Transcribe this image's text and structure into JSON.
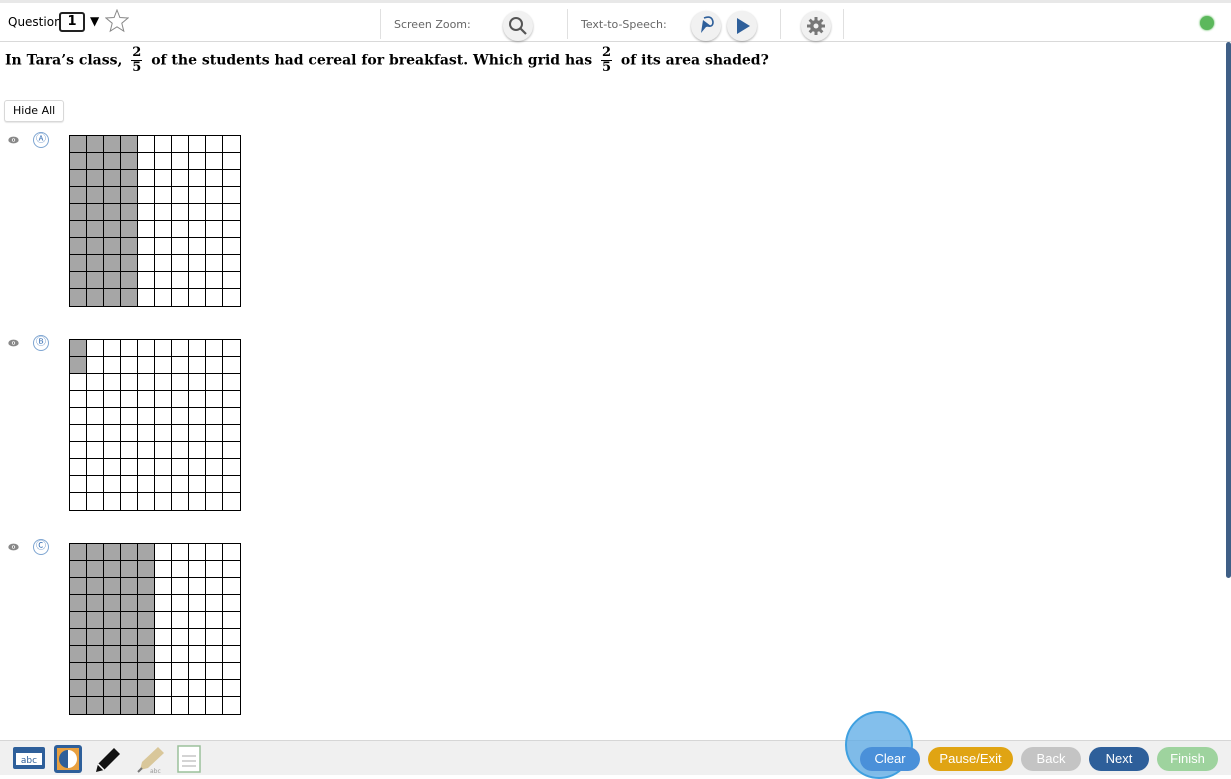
{
  "header": {
    "question_label": "Question",
    "question_number": "1",
    "dropdown_arrow": "▼",
    "screen_zoom_label": "Screen Zoom:",
    "tts_label": "Text-to-Speech:",
    "icons": [
      "star-icon",
      "zoom-search-icon",
      "tts-select-icon",
      "tts-play-icon",
      "settings-gear-icon",
      "status-dot-icon"
    ]
  },
  "question": {
    "part1": "In Tara’s class,",
    "frac1": {
      "num": "2",
      "den": "5"
    },
    "part2": "of the students had cereal for breakfast. Which grid has",
    "frac2": {
      "num": "2",
      "den": "5"
    },
    "part3": "of its area shaded?"
  },
  "hide_all_label": "Hide All",
  "options": [
    {
      "letter": "Ⓐ",
      "shaded_columns": 4,
      "shaded_cells": 40
    },
    {
      "letter": "Ⓑ",
      "shaded_columns": 0,
      "shaded_cells": 2
    },
    {
      "letter": "Ⓒ",
      "shaded_columns": 5,
      "shaded_cells": 50
    }
  ],
  "footer": {
    "tools": [
      "dictionary-abc-icon",
      "color-contrast-icon",
      "pencil-icon",
      "highlighter-icon",
      "notepad-icon"
    ],
    "buttons": {
      "clear": "Clear",
      "pause_exit": "Pause/Exit",
      "back": "Back",
      "next": "Next",
      "finish": "Finish"
    }
  },
  "colors": {
    "shaded": "#a6a6a6",
    "clear": "#4a90d9",
    "pause": "#e0a413",
    "back": "#c4c4c4",
    "next": "#2e5f9a",
    "finish": "#9ed39e",
    "status": "#5cb85c"
  }
}
